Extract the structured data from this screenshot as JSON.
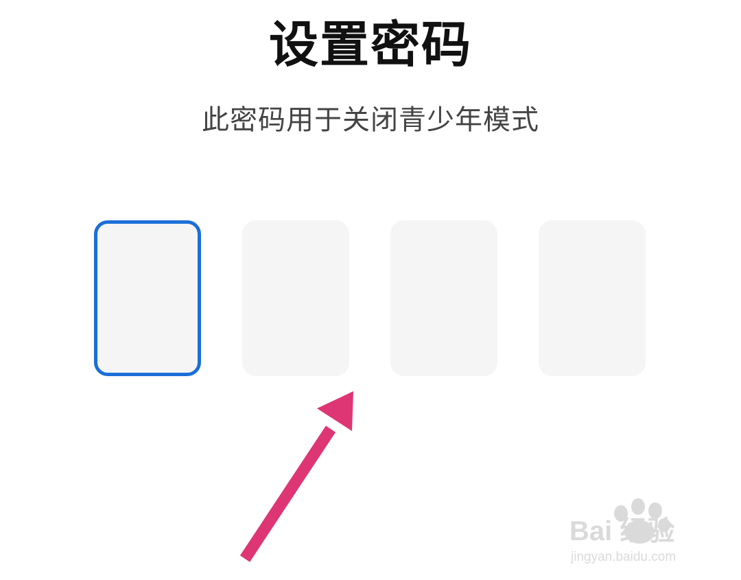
{
  "header": {
    "title": "设置密码",
    "subtitle": "此密码用于关闭青少年模式"
  },
  "passcode": {
    "length": 4,
    "active_index": 0
  },
  "watermark": {
    "brand_text": "Bai  经验",
    "url_text": "jingyan.baidu.com"
  },
  "colors": {
    "background": "#ffffff",
    "title_text": "#111111",
    "subtitle_text": "#444444",
    "box_fill": "#f5f5f5",
    "box_active_border": "#1a6fd8",
    "annotation_arrow": "#de3575",
    "watermark": "#dadada"
  },
  "icons": {
    "annotation": "arrow-pointer-icon",
    "watermark_logo": "paw-icon"
  }
}
